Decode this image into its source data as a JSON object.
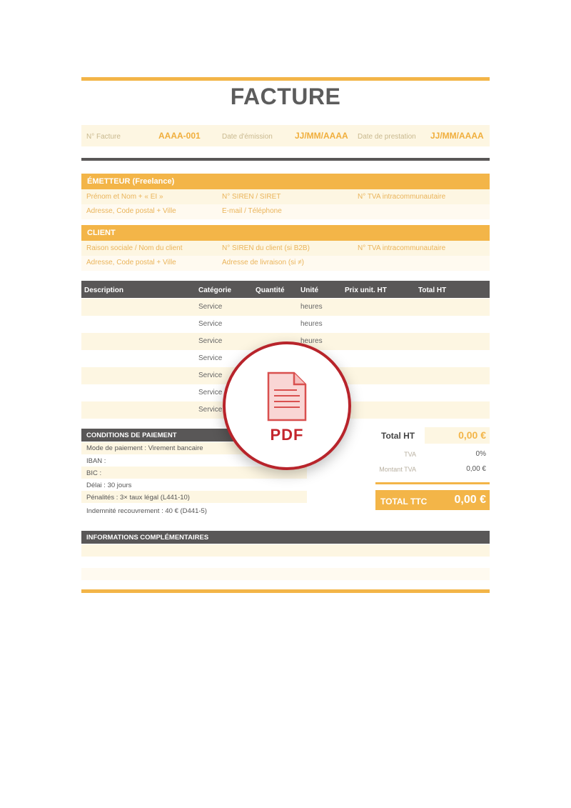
{
  "document": {
    "title": "FACTURE",
    "meta": {
      "invoice_label": "N° Facture",
      "invoice_value": "AAAA-001",
      "issue_label": "Date d'émission",
      "issue_value": "JJ/MM/AAAA",
      "service_label": "Date de prestation",
      "service_value": "JJ/MM/AAAA"
    },
    "emitter": {
      "heading": "ÉMETTEUR (Freelance)",
      "fields": [
        "Prénom et Nom + « EI »",
        "N° SIREN / SIRET",
        "N° TVA intracommunautaire",
        "Adresse, Code postal + Ville",
        "E-mail / Téléphone"
      ]
    },
    "client": {
      "heading": "CLIENT",
      "fields": [
        "Raison sociale / Nom du client",
        "N° SIREN du client (si B2B)",
        "N° TVA intracommunautaire",
        "Adresse, Code postal + Ville",
        "Adresse de livraison (si ≠)"
      ]
    },
    "table": {
      "headers": [
        "Description",
        "Catégorie",
        "Quantité",
        "Unité",
        "Prix unit. HT",
        "Total HT"
      ],
      "rows": [
        {
          "category": "Service",
          "unit": "heures"
        },
        {
          "category": "Service",
          "unit": "heures"
        },
        {
          "category": "Service",
          "unit": "heures"
        },
        {
          "category": "Service",
          "unit": ""
        },
        {
          "category": "Service",
          "unit": ""
        },
        {
          "category": "Service",
          "unit": ""
        },
        {
          "category": "Service",
          "unit": ""
        }
      ]
    },
    "payment": {
      "heading": "CONDITIONS DE PAIEMENT",
      "lines": [
        "Mode de paiement : Virement bancaire",
        "IBAN :",
        "BIC :",
        "Délai : 30 jours",
        "Pénalités : 3× taux légal (L441-10)",
        "Indemnité recouvrement : 40 € (D441-5)"
      ]
    },
    "totals": {
      "ht_label": "Total HT",
      "ht_value": "0,00 €",
      "tva_label": "TVA",
      "tva_value": "0%",
      "montant_tva_label": "Montant TVA",
      "montant_tva_value": "0,00 €",
      "ttc_label": "TOTAL TTC",
      "ttc_value": "0,00 €"
    },
    "info": {
      "heading": "INFORMATIONS COMPLÉMENTAIRES"
    },
    "overlay": {
      "label": "PDF",
      "icon": "pdf-file-icon"
    },
    "colors": {
      "accent": "#f3b548",
      "dark": "#595757",
      "pdf_red": "#b8242b"
    }
  }
}
